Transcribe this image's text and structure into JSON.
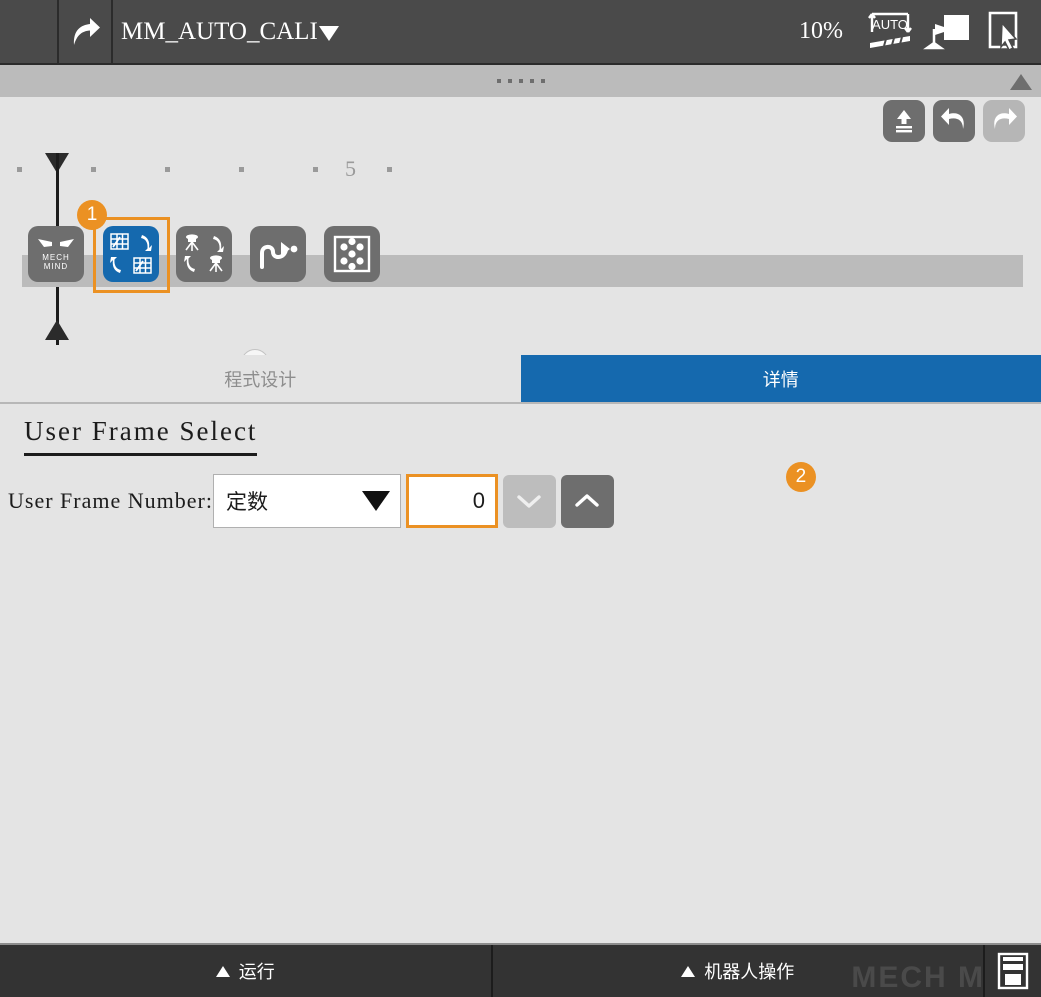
{
  "header": {
    "menu_icon": "hamburger-list-icon",
    "share_icon": "forward-arrow-icon",
    "program_name": "MM_AUTO_CALI",
    "dropdown_icon": "caret-down-icon",
    "speed": "10%",
    "auto_icon": "auto-mode-icon",
    "tool_icon": "tool-frame-icon",
    "touch_icon": "touch-panel-icon"
  },
  "handle": {
    "grip_icon": "drag-dots-icon",
    "collapse_icon": "triangle-up-icon"
  },
  "editor_toolbar": {
    "upload_icon": "upload-icon",
    "undo_icon": "undo-icon",
    "redo_icon": "redo-icon"
  },
  "canvas": {
    "ruler": {
      "label_5": "5",
      "ticks": [
        18,
        92,
        166,
        240,
        314,
        388
      ],
      "label_x": 345
    },
    "playhead_top_icon": "playhead-down-triangle-icon",
    "playhead_bottom_icon": "playhead-up-triangle-icon",
    "nodes": [
      {
        "name": "mech-mind-logo-node",
        "label_line1": "MECH",
        "label_line2": "MIND",
        "icon": "mech-mind-eyes-icon",
        "selected": false
      },
      {
        "name": "calibration-node",
        "icon": "frame-swap-icon",
        "selected": true,
        "badge": "1"
      },
      {
        "name": "tool-swap-node",
        "icon": "tool-swap-icon",
        "selected": false
      },
      {
        "name": "move-path-node",
        "icon": "path-move-icon",
        "selected": false,
        "pin": "1"
      },
      {
        "name": "grid-points-node",
        "icon": "dot-grid-icon",
        "selected": false
      }
    ]
  },
  "tabs": [
    {
      "label": "程式设计",
      "active": false
    },
    {
      "label": "详情",
      "active": true
    }
  ],
  "form": {
    "section_title": "User Frame Select",
    "field_label": "User Frame Number:",
    "select_value": "定数",
    "select_caret_icon": "caret-down-icon",
    "number_value": "0",
    "step_down_icon": "chevron-down-icon",
    "step_up_icon": "chevron-up-icon",
    "badge": "2"
  },
  "bottom": {
    "run_label": "运行",
    "robot_label": "机器人操作",
    "run_arrow_icon": "triangle-up-icon",
    "robot_arrow_icon": "triangle-up-icon",
    "save_icon": "save-disk-icon",
    "watermark": "MECH M"
  },
  "colors": {
    "accent_blue": "#1569ae",
    "accent_orange": "#eb9123",
    "header_dark": "#4a4a4a",
    "background": "#e4e4e4"
  }
}
